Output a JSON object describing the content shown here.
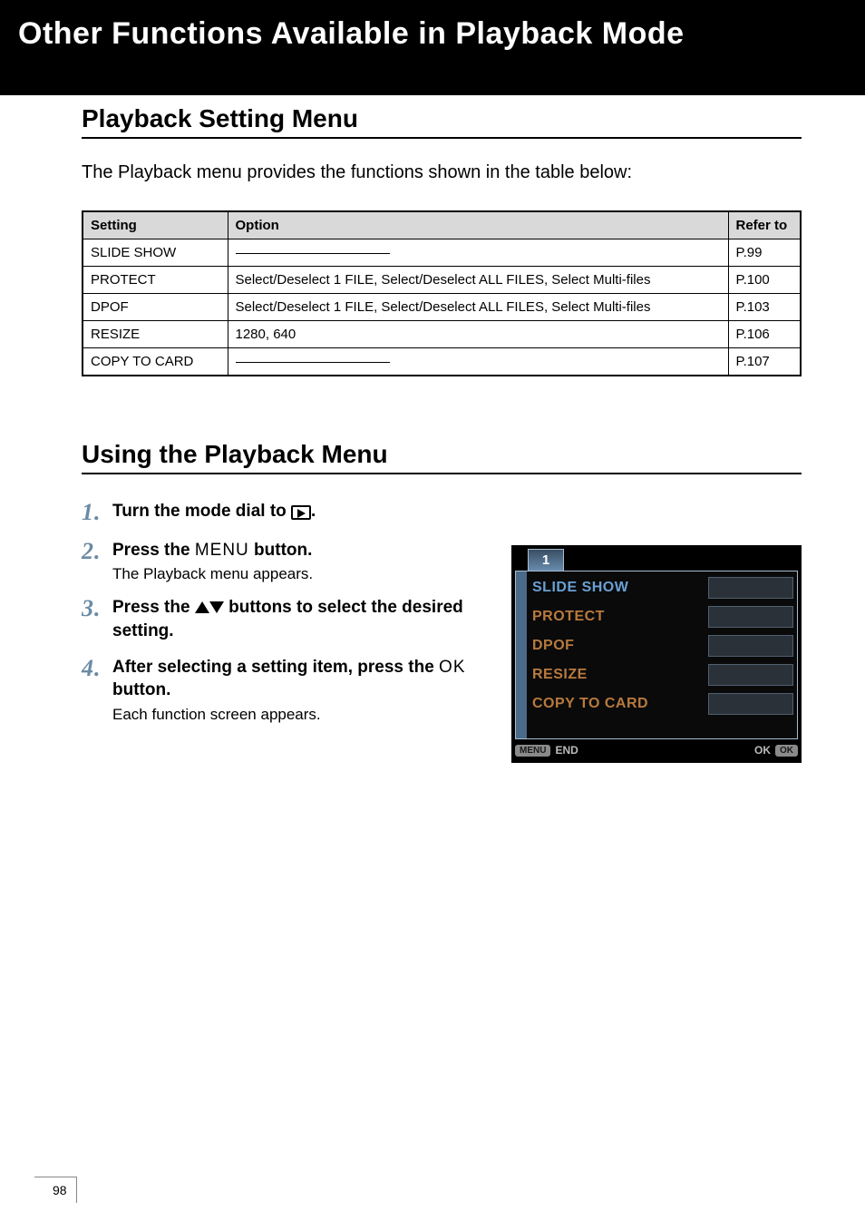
{
  "header": {
    "title": "Other Functions Available in Playback Mode"
  },
  "section1": {
    "heading": "Playback Setting Menu",
    "intro": "The Playback menu provides the functions shown in the table below:"
  },
  "table": {
    "headers": {
      "setting": "Setting",
      "option": "Option",
      "refer": "Refer to"
    },
    "rows": [
      {
        "setting": "SLIDE SHOW",
        "option": "",
        "refer": "P.99",
        "dash": true
      },
      {
        "setting": "PROTECT",
        "option": "Select/Deselect 1 FILE, Select/Deselect ALL FILES, Select Multi-files",
        "refer": "P.100",
        "dash": false
      },
      {
        "setting": "DPOF",
        "option": "Select/Deselect 1 FILE, Select/Deselect ALL FILES, Select Multi-files",
        "refer": "P.103",
        "dash": false
      },
      {
        "setting": "RESIZE",
        "option": "1280,  640",
        "refer": "P.106",
        "dash": false
      },
      {
        "setting": "COPY TO CARD",
        "option": "",
        "refer": "P.107",
        "dash": true
      }
    ]
  },
  "section2": {
    "heading": "Using the Playback Menu"
  },
  "steps": {
    "s1_pre": "Turn the mode dial to ",
    "s1_post": ".",
    "s2_pre": "Press the ",
    "s2_btn": "MENU",
    "s2_post": " button.",
    "s2_desc": "The Playback menu appears.",
    "s3_pre": "Press the ",
    "s3_post": " buttons to select the desired setting.",
    "s4_pre": "After selecting a setting item, press the ",
    "s4_btn": "OK",
    "s4_post": " button.",
    "s4_desc": "Each function screen appears."
  },
  "lcd": {
    "tab": "1",
    "items": [
      "SLIDE SHOW",
      "PROTECT",
      "DPOF",
      "RESIZE",
      "COPY TO CARD"
    ],
    "footer": {
      "menu": "MENU",
      "end": "END",
      "ok1": "OK",
      "ok2": "OK"
    }
  },
  "page": "98"
}
